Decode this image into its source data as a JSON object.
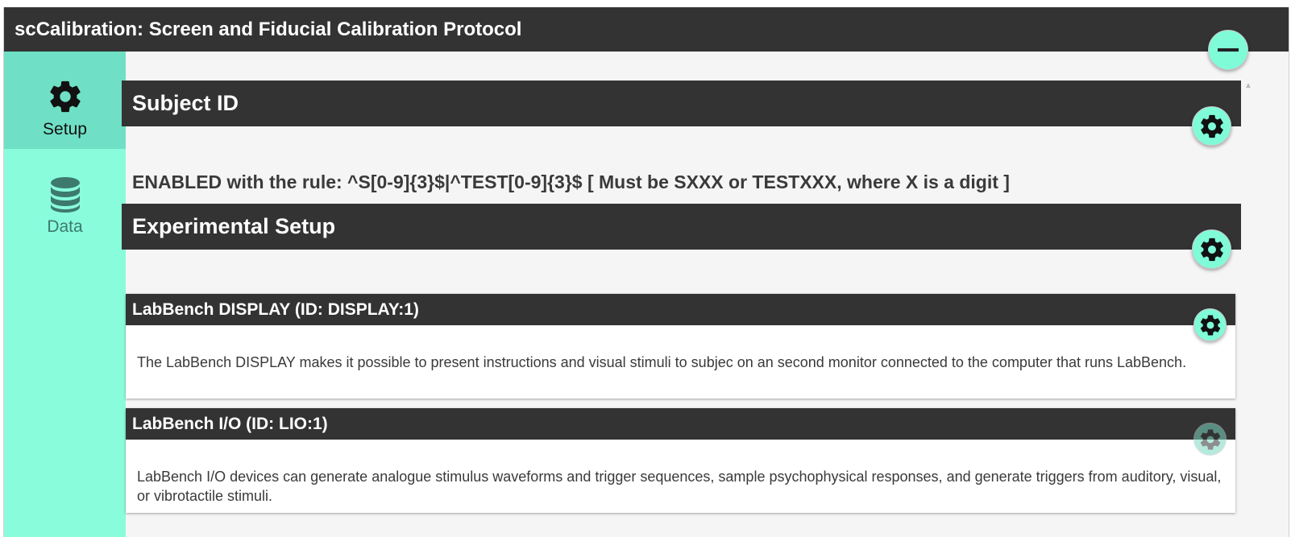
{
  "window": {
    "title": "scCalibration: Screen and Fiducial Calibration Protocol"
  },
  "sidebar": {
    "items": [
      {
        "label": "Setup",
        "icon": "gear-icon",
        "active": true
      },
      {
        "label": "Data",
        "icon": "database-icon",
        "active": false
      }
    ]
  },
  "sections": {
    "subject_id": {
      "title": "Subject ID",
      "rule_text": "ENABLED with the rule: ^S[0-9]{3}$|^TEST[0-9]{3}$ [ Must be SXXX or TESTXXX, where X is a digit ]"
    },
    "experimental_setup": {
      "title": "Experimental Setup",
      "devices": [
        {
          "title": "LabBench DISPLAY (ID: DISPLAY:1)",
          "description": "The LabBench DISPLAY makes it possible to present instructions and visual stimuli to subjec on an second monitor connected to the computer that runs LabBench."
        },
        {
          "title": "LabBench I/O (ID: LIO:1)",
          "description": "LabBench I/O devices can generate analogue stimulus waveforms and trigger sequences, sample psychophysical responses, and generate triggers from auditory, visual, or vibrotactile stimuli."
        }
      ]
    }
  },
  "colors": {
    "accent": "#7ffbd8",
    "sidebar_bg": "#89fcdc",
    "sidebar_active": "#6fe0c5",
    "header_bg": "#333333"
  }
}
